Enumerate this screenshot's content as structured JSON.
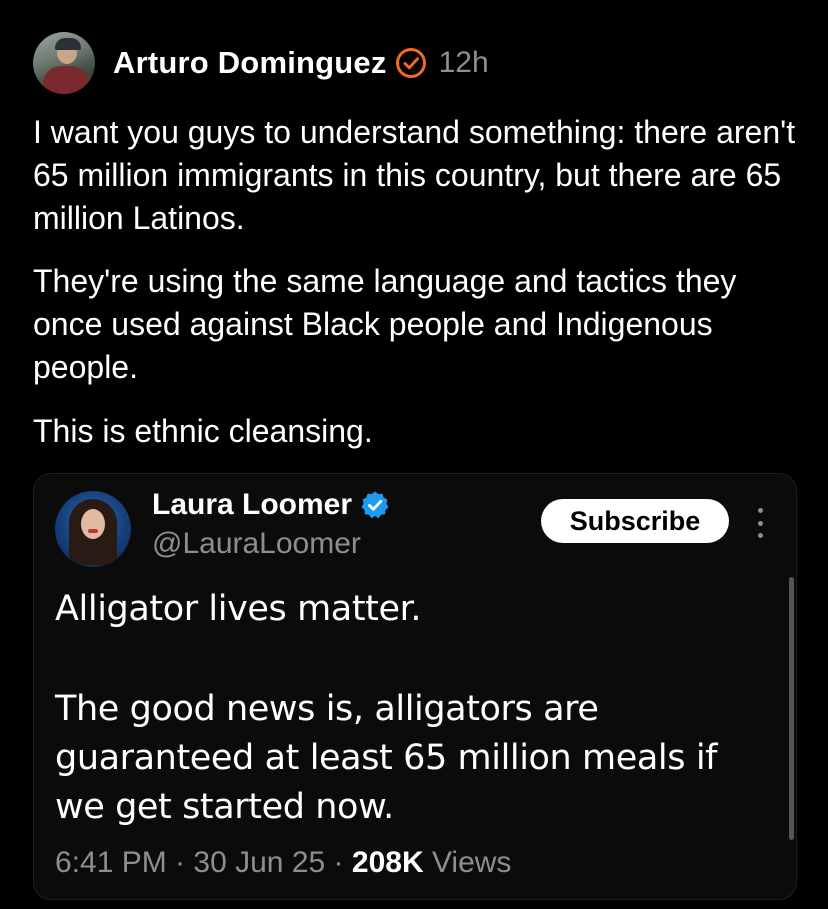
{
  "post": {
    "author_name": "Arturo Dominguez",
    "time": "12h",
    "paragraphs": [
      "I want you guys to understand something: there aren't 65 million immigrants in this country, but there are 65 million Latinos.",
      "They're using the same language and tactics they once used against Black people and Indigenous people.",
      "This is ethnic cleansing."
    ]
  },
  "quote": {
    "name": "Laura Loomer",
    "handle": "@LauraLoomer",
    "subscribe_label": "Subscribe",
    "paragraphs": [
      "Alligator lives matter.",
      "The good news is, alligators are guaranteed at least 65 million meals if we get started now."
    ],
    "time": "6:41 PM",
    "date": "30 Jun 25",
    "separator": "·",
    "views_count": "208K",
    "views_label": "Views"
  },
  "colors": {
    "background": "#000000",
    "secondary_text": "#8b8f94",
    "verified_orange": "#f26a21",
    "verified_blue": "#1d9bf0"
  },
  "icons": [
    "verified-badge-orange-icon",
    "verified-badge-blue-icon",
    "more-options-icon"
  ]
}
